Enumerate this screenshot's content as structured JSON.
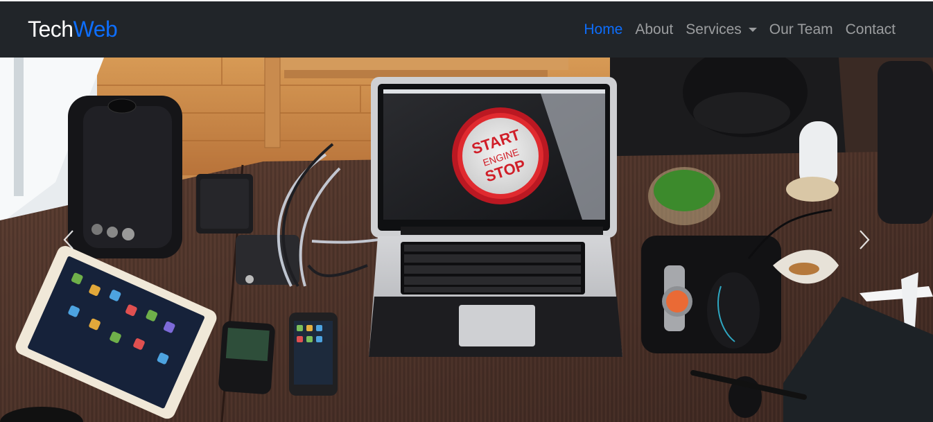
{
  "brand": {
    "part1": "Tech",
    "part2": "Web"
  },
  "nav": {
    "home": "Home",
    "about": "About",
    "services": "Services",
    "team": "Our Team",
    "contact": "Contact"
  },
  "photo": {
    "button_line1": "START",
    "button_line2": "ENGINE",
    "button_line3": "STOP"
  },
  "colors": {
    "navbar": "#212529",
    "accent": "#0d6efd"
  },
  "icons": [
    "chevron-left-icon",
    "chevron-right-icon",
    "caret-down-icon"
  ]
}
